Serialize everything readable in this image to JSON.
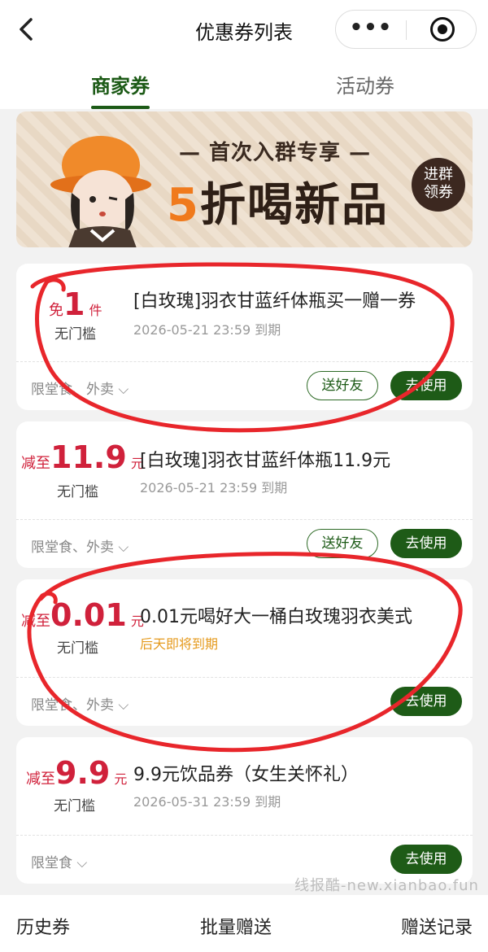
{
  "header": {
    "title": "优惠券列表",
    "more_glyph": "•••"
  },
  "tabs": [
    {
      "label": "商家券"
    },
    {
      "label": "活动券"
    }
  ],
  "banner": {
    "line1": "— 首次入群专享 —",
    "line2_highlight": "5",
    "line2_rest": "折喝新品",
    "join_label_1": "进群",
    "join_label_2": "领券"
  },
  "coupons": [
    {
      "prefix": "免",
      "amount": "1",
      "unit": "件",
      "threshold": "无门槛",
      "name": "[白玫瑰]羽衣甘蓝纤体瓶买一赠一券",
      "expiry": "2026-05-21 23:59 到期",
      "scope": "限堂食、外卖",
      "friend_label": "送好友",
      "use_label": "去使用"
    },
    {
      "prefix": "减至",
      "amount": "11.9",
      "unit": "元",
      "threshold": "无门槛",
      "name": "[白玫瑰]羽衣甘蓝纤体瓶11.9元",
      "expiry": "2026-05-21 23:59 到期",
      "scope": "限堂食、外卖",
      "friend_label": "送好友",
      "use_label": "去使用"
    },
    {
      "prefix": "减至",
      "amount": "0.01",
      "unit": "元",
      "threshold": "无门槛",
      "name": "0.01元喝好大一桶白玫瑰羽衣美式",
      "expiry": "后天即将到期",
      "scope": "限堂食、外卖",
      "use_label": "去使用"
    },
    {
      "prefix": "减至",
      "amount": "9.9",
      "unit": "元",
      "threshold": "无门槛",
      "name": "9.9元饮品券（女生关怀礼）",
      "expiry": "2026-05-31 23:59 到期",
      "scope": "限堂食",
      "use_label": "去使用"
    }
  ],
  "watermark": "线报酷-new.xianbao.fun",
  "footer": {
    "history": "历史券",
    "batch": "批量赠送",
    "records": "赠送记录"
  },
  "colors": {
    "brand_green": "#1e5b17",
    "price_red": "#d0213b",
    "warn_orange": "#e59a1d",
    "annotation_red": "#e8262b"
  }
}
